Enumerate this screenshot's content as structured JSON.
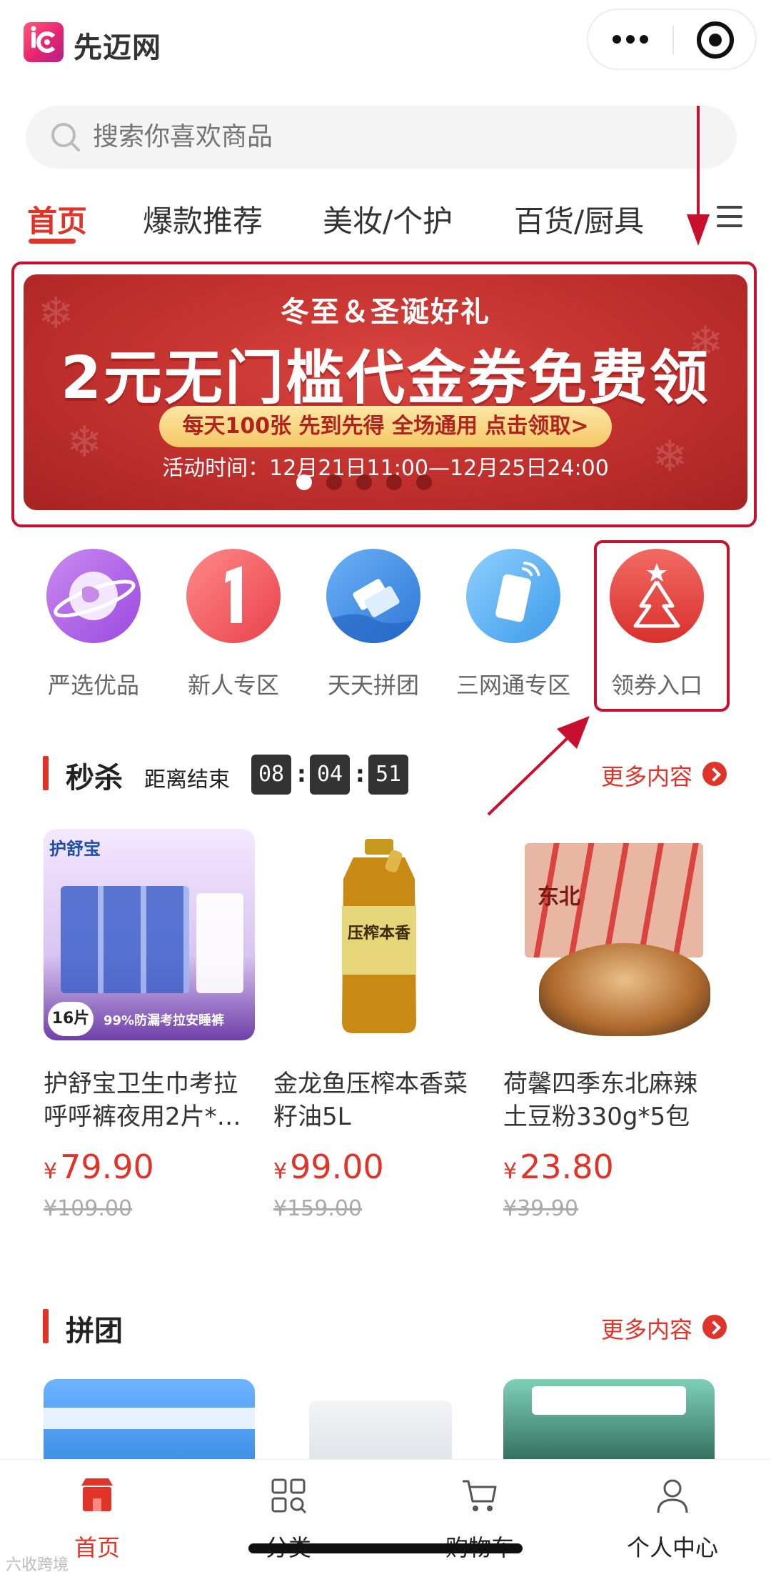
{
  "app": {
    "title": "先迈网"
  },
  "search": {
    "placeholder": "搜索你喜欢商品"
  },
  "tabs": [
    {
      "label": "首页",
      "active": true
    },
    {
      "label": "爆款推荐",
      "active": false
    },
    {
      "label": "美妆/个护",
      "active": false
    },
    {
      "label": "百货/厨具",
      "active": false
    }
  ],
  "banner": {
    "subtitle": "冬至＆圣诞好礼",
    "title": "2元无门槛代金券免费领",
    "pill": "每天100张 先到先得 全场通用 点击领取>",
    "time": "活动时间：12月21日11:00—12月25日24:00",
    "active_slide": 1,
    "slide_count": 5
  },
  "categories": [
    {
      "label": "严选优品",
      "icon": "planet-icon"
    },
    {
      "label": "新人专区",
      "icon": "number-one-icon"
    },
    {
      "label": "天天拼团",
      "icon": "tag-icon"
    },
    {
      "label": "三网通专区",
      "icon": "phone-icon"
    },
    {
      "label": "领券入口",
      "icon": "christmas-tree-icon"
    }
  ],
  "flash_sale": {
    "title": "秒杀",
    "countdown_label": "距离结束",
    "hours": "08",
    "minutes": "04",
    "seconds": "51",
    "more": "更多内容"
  },
  "products": [
    {
      "name": "护舒宝卫生巾考拉呼呼裤夜用2片*…",
      "price": "79.90",
      "original_price": "¥109.00",
      "currency": "¥",
      "image_text": "护舒宝",
      "image_badge": "16片",
      "image_caption": "99%防漏考拉安睡裤"
    },
    {
      "name": "金龙鱼压榨本香菜籽油5L",
      "price": "99.00",
      "original_price": "¥159.00",
      "currency": "¥",
      "image_text": "压榨本香"
    },
    {
      "name": "荷馨四季东北麻辣土豆粉330g*5包",
      "price": "23.80",
      "original_price": "¥39.90",
      "currency": "¥",
      "image_text": "东北"
    }
  ],
  "group_buy": {
    "title": "拼团",
    "more": "更多内容"
  },
  "tabbar": [
    {
      "label": "首页",
      "icon": "home-store-icon",
      "active": true
    },
    {
      "label": "分类",
      "icon": "grid-search-icon",
      "active": false
    },
    {
      "label": "购物车",
      "icon": "cart-icon",
      "active": false
    },
    {
      "label": "个人中心",
      "icon": "user-icon",
      "active": false
    }
  ],
  "watermark": "六收跨境",
  "colors": {
    "accent": "#e0342a",
    "annotation": "#c8102e",
    "banner": "#c0302d"
  }
}
